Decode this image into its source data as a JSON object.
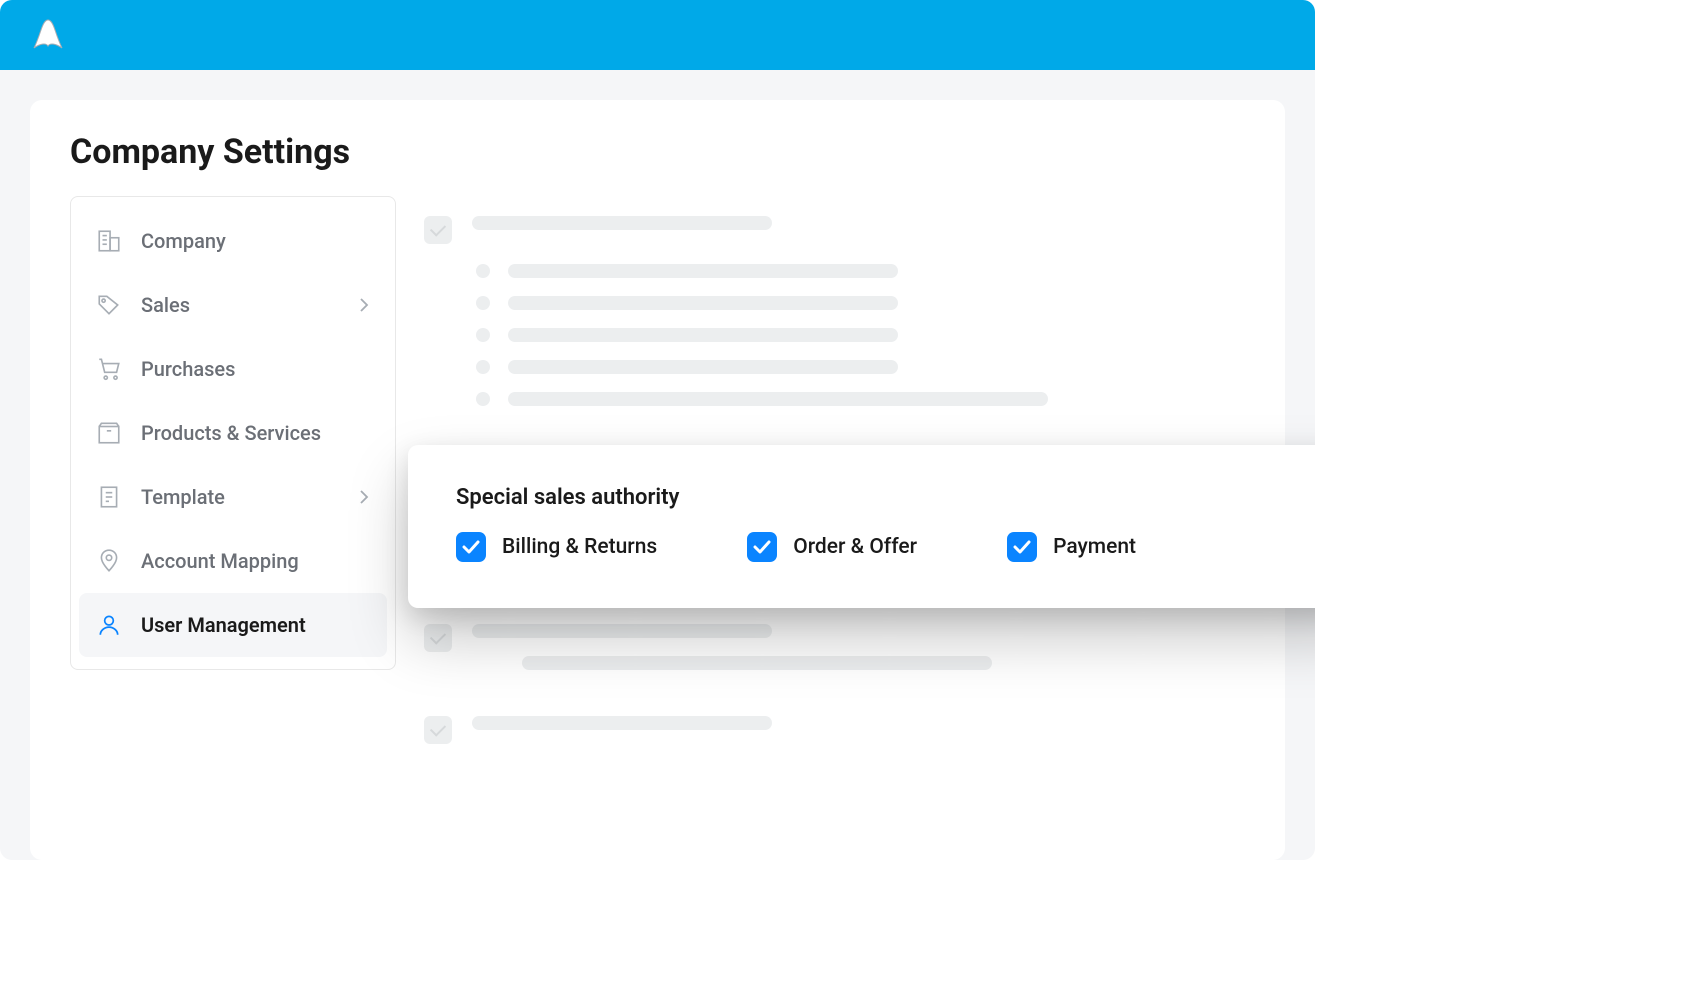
{
  "header": {
    "page_title": "Company Settings"
  },
  "sidebar": {
    "items": [
      {
        "label": "Company",
        "icon": "building-icon",
        "has_chevron": false
      },
      {
        "label": "Sales",
        "icon": "tag-icon",
        "has_chevron": true
      },
      {
        "label": "Purchases",
        "icon": "cart-icon",
        "has_chevron": false
      },
      {
        "label": "Products & Services",
        "icon": "box-icon",
        "has_chevron": false
      },
      {
        "label": "Template",
        "icon": "document-icon",
        "has_chevron": true
      },
      {
        "label": "Account Mapping",
        "icon": "map-pin-icon",
        "has_chevron": false
      },
      {
        "label": "User Management",
        "icon": "user-icon",
        "has_chevron": false
      }
    ],
    "active_index": 6
  },
  "popover": {
    "title": "Special sales authority",
    "options": [
      {
        "label": "Billing & Returns",
        "checked": true
      },
      {
        "label": "Order & Offer",
        "checked": true
      },
      {
        "label": "Payment",
        "checked": true
      }
    ]
  },
  "colors": {
    "brand_blue": "#00a9e8",
    "accent_blue": "#0a84ff"
  }
}
